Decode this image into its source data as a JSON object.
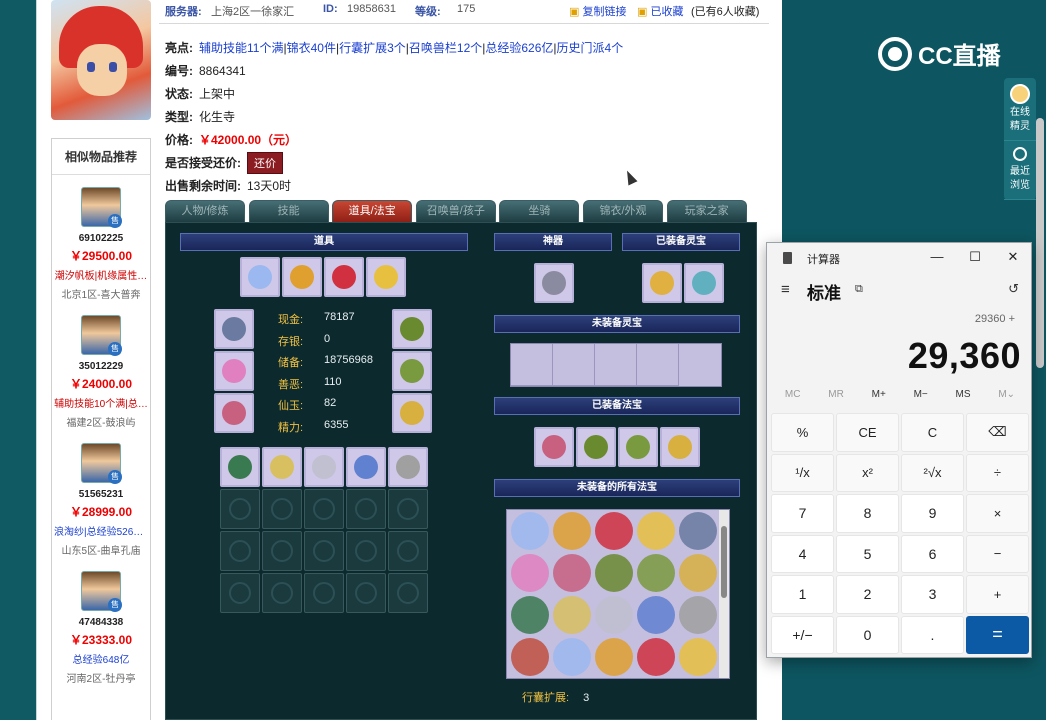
{
  "overlay": {
    "brand": "CC直播",
    "rail": [
      {
        "label_1": "在线",
        "label_2": "精灵"
      },
      {
        "label_1": "最近",
        "label_2": "浏览"
      }
    ]
  },
  "topbar": {
    "server_label": "服务器:",
    "server_value": "上海2区一徐家汇",
    "id_label": "ID:",
    "id_value": "19858631",
    "level_label": "等级:",
    "level_value": "175",
    "copy_link": "复制链接",
    "favorited": "已收藏",
    "fav_count": "(已有6人收藏)"
  },
  "info": {
    "highlights_label": "亮点:",
    "highlights": [
      "辅助技能11个满",
      "锦衣40件",
      "行囊扩展3个",
      "召唤兽栏12个",
      "总经验626亿",
      "历史门派4个"
    ],
    "number_label": "编号:",
    "number_value": "8864341",
    "status_label": "状态:",
    "status_value": "上架中",
    "type_label": "类型:",
    "type_value": "化生寺",
    "price_label": "价格:",
    "price_value": "￥42000.00（元）",
    "haggle_label": "是否接受还价:",
    "haggle_button": "还价",
    "remaining_label": "出售剩余时间:",
    "remaining_value": "13天0时"
  },
  "tabs": [
    "人物/修炼",
    "技能",
    "道具/法宝",
    "召唤兽/孩子",
    "坐骑",
    "锦衣/外观",
    "玩家之家"
  ],
  "panel": {
    "items_title": "道具",
    "artifact_title": "神器",
    "equipped_spirit_title": "已装备灵宝",
    "unequipped_spirit_title": "未装备灵宝",
    "equipped_fabao_title": "已装备法宝",
    "unequipped_fabao_title": "未装备的所有法宝",
    "stats": [
      {
        "k": "现金:",
        "v": "78187"
      },
      {
        "k": "存银:",
        "v": "0"
      },
      {
        "k": "储备:",
        "v": "18756968"
      },
      {
        "k": "善恶:",
        "v": "110"
      },
      {
        "k": "仙玉:",
        "v": "82"
      },
      {
        "k": "精力:",
        "v": "6355"
      }
    ],
    "bag_expand_label": "行囊扩展:",
    "bag_expand_value": "3"
  },
  "similar": {
    "title": "相似物品推荐",
    "items": [
      {
        "id": "69102225",
        "price": "￥29500.00",
        "highlight": "潮汐帆板|机缘属性…",
        "server": "北京1区-喜大普奔",
        "hl_color": "red"
      },
      {
        "id": "35012229",
        "price": "￥24000.00",
        "highlight": "辅助技能10个满|总…",
        "server": "福建2区-鼓浪屿",
        "hl_color": "red"
      },
      {
        "id": "51565231",
        "price": "￥28999.00",
        "highlight": "浪淘纱|总经验526亿…",
        "server": "山东5区-曲阜孔庙",
        "hl_color": "blue"
      },
      {
        "id": "47484338",
        "price": "￥23333.00",
        "highlight": "总经验648亿",
        "server": "河南2区-牡丹亭",
        "hl_color": "blue"
      }
    ]
  },
  "calculator": {
    "title": "计算器",
    "mode": "标准",
    "expression": "29360 +",
    "display": "29,360",
    "memory": [
      "MC",
      "MR",
      "M+",
      "M−",
      "MS",
      "M⌄"
    ],
    "keys": [
      "%",
      "CE",
      "C",
      "⌫",
      "¹/x",
      "x²",
      "²√x",
      "÷",
      "7",
      "8",
      "9",
      "×",
      "4",
      "5",
      "6",
      "−",
      "1",
      "2",
      "3",
      "+",
      "+/−",
      "0",
      ".",
      "="
    ]
  }
}
